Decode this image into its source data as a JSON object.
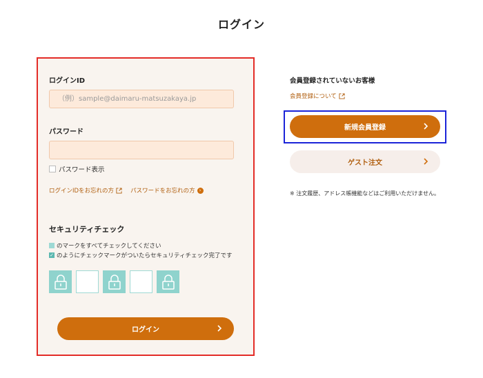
{
  "page": {
    "title": "ログイン"
  },
  "login_form": {
    "id_label": "ログインID",
    "id_placeholder": "（例）sample@daimaru-matsuzakaya.jp",
    "password_label": "パスワード",
    "password_placeholder": "",
    "show_password_label": "パスワード表示",
    "forgot_id_link": "ログインIDをお忘れの方",
    "forgot_password_link": "パスワードをお忘れの方",
    "security": {
      "title": "セキュリティチェック",
      "instruction_1": "のマークをすべてチェックしてください",
      "instruction_2": "のようにチェックマークがついたらセキュリティチェック完了です",
      "check_glyph": "✓",
      "tiles": [
        "lock",
        "empty",
        "lock",
        "empty",
        "lock"
      ]
    },
    "submit_label": "ログイン"
  },
  "guest_panel": {
    "title": "会員登録されていないお客様",
    "about_link": "会員登録について",
    "register_label": "新規会員登録",
    "guest_order_label": "ゲスト注文",
    "notice": "※ 注文履歴、アドレス帳機能などはご利用いただけません。"
  },
  "colors": {
    "accent": "#cf6e0d",
    "link": "#b05e0e",
    "input_bg": "#fdeadb",
    "panel_bg": "#f9f4ef",
    "lock_teal": "#8fd3cd",
    "highlight_red": "#e32b26",
    "highlight_blue": "#1a22d8"
  },
  "icons": {
    "external_link": "external-link-icon",
    "circle_arrow": "circle-arrow-icon",
    "chevron": "chevron-right-icon",
    "lock": "lock-icon"
  }
}
